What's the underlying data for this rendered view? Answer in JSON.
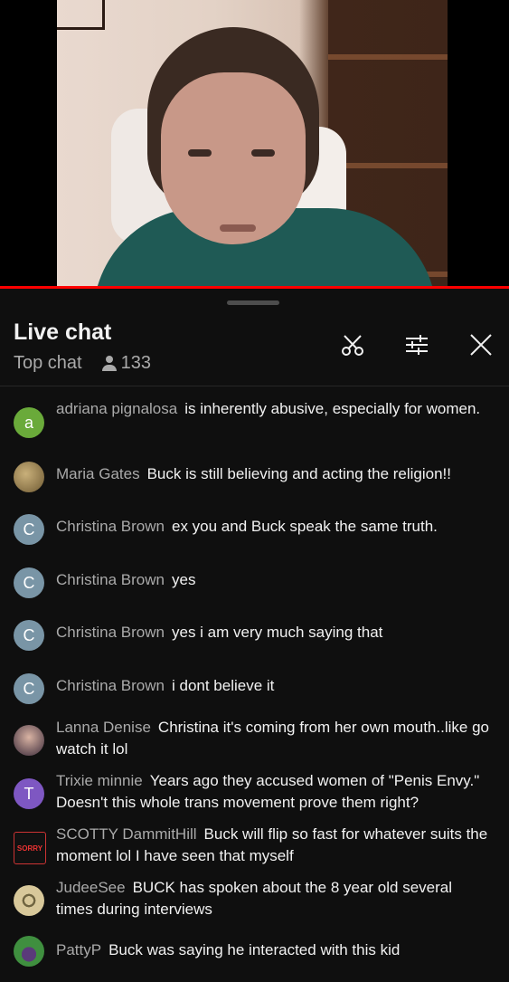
{
  "chat": {
    "title": "Live chat",
    "mode": "Top chat",
    "viewer_count": "133",
    "icons": [
      "scissors-icon",
      "filter-icon",
      "close-icon"
    ]
  },
  "messages": [
    {
      "author": "adriana pignalosa",
      "text": "is inherently abusive, especially for women.",
      "avatar_letter": "a",
      "avatar_color": "#6aaa3a"
    },
    {
      "author": "Maria Gates",
      "text": "Buck is still believing and acting the religion!!",
      "avatar_letter": "",
      "avatar_color": "#8a7a4a"
    },
    {
      "author": "Christina Brown",
      "text": "ex you and Buck speak the same truth.",
      "avatar_letter": "C",
      "avatar_color": "#7995a6"
    },
    {
      "author": "Christina Brown",
      "text": "yes",
      "avatar_letter": "C",
      "avatar_color": "#7995a6"
    },
    {
      "author": "Christina Brown",
      "text": "yes i am very much saying that",
      "avatar_letter": "C",
      "avatar_color": "#7995a6"
    },
    {
      "author": "Christina Brown",
      "text": "i dont believe it",
      "avatar_letter": "C",
      "avatar_color": "#7995a6"
    },
    {
      "author": "Lanna Denise",
      "text": "Christina it's coming from her own mouth..like go watch it lol",
      "avatar_letter": "",
      "avatar_color": "#5a4a5a"
    },
    {
      "author": "Trixie minnie",
      "text": "Years ago they accused women of \"Penis Envy.\" Doesn't this whole trans movement prove them right?",
      "avatar_letter": "T",
      "avatar_color": "#7e57c2"
    },
    {
      "author": "SCOTTY DammitHill",
      "text": "Buck will flip so fast for whatever suits the moment lol I have seen that myself",
      "avatar_letter": "SORRY",
      "avatar_color": "#222222"
    },
    {
      "author": "JudeeSee",
      "text": "BUCK has spoken about the 8 year old several times during interviews",
      "avatar_letter": "",
      "avatar_color": "#b7a77a"
    },
    {
      "author": "PattyP",
      "text": "Buck was saying he interacted with this kid",
      "avatar_letter": "",
      "avatar_color": "#3f8f3f"
    }
  ]
}
